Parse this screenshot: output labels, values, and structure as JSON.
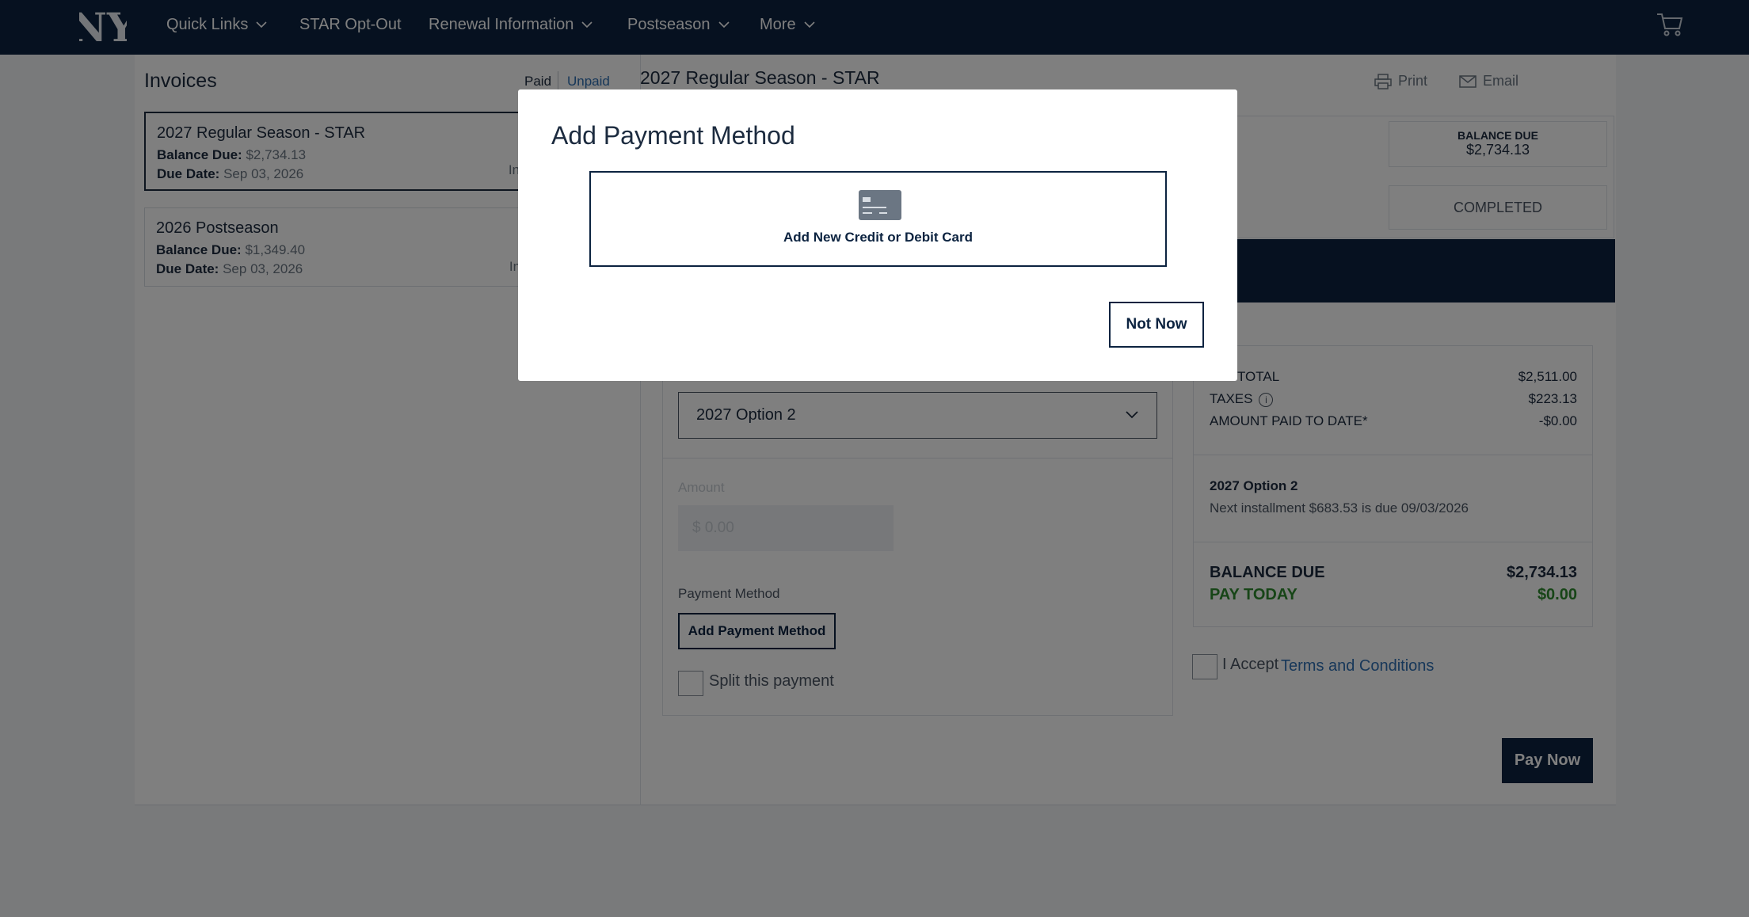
{
  "nav": {
    "items": [
      {
        "label": "Quick Links",
        "has_dropdown": true
      },
      {
        "label": "STAR Opt-Out",
        "has_dropdown": false
      },
      {
        "label": "Renewal Information",
        "has_dropdown": true
      },
      {
        "label": "Postseason",
        "has_dropdown": true
      },
      {
        "label": "More",
        "has_dropdown": true
      }
    ]
  },
  "invoices": {
    "title": "Invoices",
    "tab_paid": "Paid",
    "tab_unpaid": "Unpaid",
    "cards": [
      {
        "name": "2027 Regular Season - STAR",
        "balance_label": "Balance Due:",
        "balance": "$2,734.13",
        "due_label": "Due Date:",
        "due": "Sep 03, 2026",
        "link": "Invo"
      },
      {
        "name": "2026 Postseason",
        "balance_label": "Balance Due:",
        "balance": "$1,349.40",
        "due_label": "Due Date:",
        "due": "Sep 03, 2026",
        "link": "Invo"
      }
    ]
  },
  "detail": {
    "title": "2027 Regular Season - STAR",
    "print": "Print",
    "email": "Email",
    "balance_due_label": "BALANCE DUE",
    "balance_due_value": "$2,734.13",
    "status": "COMPLETED"
  },
  "form": {
    "plan_selected": "2027 Option 2",
    "amount_label": "Amount",
    "amount_placeholder": "$ 0.00",
    "payment_method_label": "Payment Method",
    "add_payment_method": "Add Payment Method",
    "split_label": "Split this payment"
  },
  "summary": {
    "subtotal_label": "SUBTOTAL",
    "subtotal": "$2,511.00",
    "taxes_label": "TAXES",
    "taxes": "$223.13",
    "paid_label": "AMOUNT PAID TO DATE*",
    "paid": "-$0.00",
    "option_title": "2027 Option 2",
    "option_text": "Next installment $683.53 is due 09/03/2026",
    "balance_label": "BALANCE DUE",
    "balance": "$2,734.13",
    "pay_today_label": "PAY TODAY",
    "pay_today": "$0.00",
    "accept_label": "I Accept",
    "terms_link": "Terms and Conditions",
    "pay_now": "Pay Now"
  },
  "modal": {
    "title": "Add Payment Method",
    "card_option": "Add New Credit or Debit Card",
    "not_now": "Not Now"
  },
  "colors": {
    "navy": "#0c2340",
    "link_blue": "#2f6fb3",
    "green": "#2e8b2e"
  },
  "icons": [
    "yankees-logo-icon",
    "chevron-down-icon",
    "cart-icon",
    "print-icon",
    "email-icon",
    "info-icon",
    "credit-card-icon"
  ]
}
